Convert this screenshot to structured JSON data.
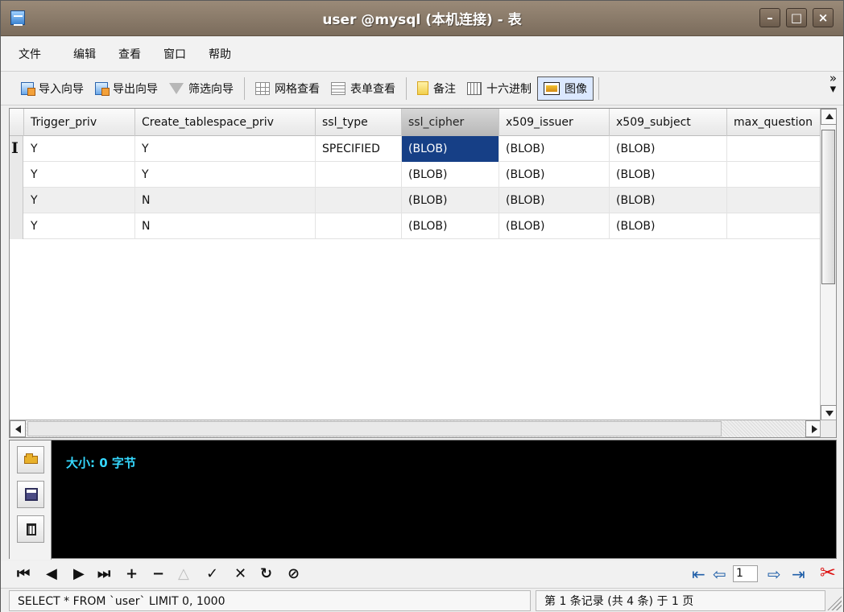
{
  "window": {
    "title": "user @mysql (本机连接) - 表"
  },
  "menu": [
    {
      "label": "文件"
    },
    {
      "label": "编辑"
    },
    {
      "label": "查看"
    },
    {
      "label": "窗口"
    },
    {
      "label": "帮助"
    }
  ],
  "toolbar": {
    "import_wizard": "导入向导",
    "export_wizard": "导出向导",
    "filter_wizard": "筛选向导",
    "grid_view": "网格查看",
    "form_view": "表单查看",
    "note": "备注",
    "hex": "十六进制",
    "image": "图像",
    "more": "»"
  },
  "grid": {
    "columns": [
      {
        "label": "Trigger_priv"
      },
      {
        "label": "Create_tablespace_priv"
      },
      {
        "label": "ssl_type"
      },
      {
        "label": "ssl_cipher"
      },
      {
        "label": "x509_issuer"
      },
      {
        "label": "x509_subject"
      },
      {
        "label": "max_question"
      }
    ],
    "rows": [
      {
        "cells": [
          "Y",
          "Y",
          "SPECIFIED",
          "(BLOB)",
          "(BLOB)",
          "(BLOB)",
          ""
        ]
      },
      {
        "cells": [
          "Y",
          "Y",
          "",
          "(BLOB)",
          "(BLOB)",
          "(BLOB)",
          ""
        ]
      },
      {
        "cells": [
          "Y",
          "N",
          "",
          "(BLOB)",
          "(BLOB)",
          "(BLOB)",
          ""
        ]
      },
      {
        "cells": [
          "Y",
          "N",
          "",
          "(BLOB)",
          "(BLOB)",
          "(BLOB)",
          ""
        ]
      }
    ]
  },
  "blob_editor": {
    "size_text": "大小: 0 字节"
  },
  "navigation": {
    "page": "1"
  },
  "status": {
    "sql": "SELECT * FROM `user` LIMIT 0, 1000",
    "records": "第 1 条记录 (共 4 条) 于 1 页"
  },
  "icons": [
    "app-table-icon",
    "minimize-icon",
    "maximize-icon",
    "close-icon",
    "import-wizard-icon",
    "export-wizard-icon",
    "filter-icon",
    "grid-view-icon",
    "form-view-icon",
    "note-icon",
    "hex-icon",
    "image-icon",
    "folder-icon",
    "save-icon",
    "trash-icon",
    "first-record-icon",
    "previous-record-icon",
    "next-record-icon",
    "last-record-icon",
    "add-record-icon",
    "delete-record-icon",
    "confirm-icon",
    "cancel-icon",
    "refresh-icon",
    "stop-icon",
    "first-page-icon",
    "previous-page-icon",
    "next-page-icon",
    "last-page-icon",
    "tools-icon"
  ],
  "colors": {
    "titlebar": "#7b6c5c",
    "selected_cell": "#163f86",
    "blob_text": "#35d8ff",
    "blob_background": "#000000"
  }
}
